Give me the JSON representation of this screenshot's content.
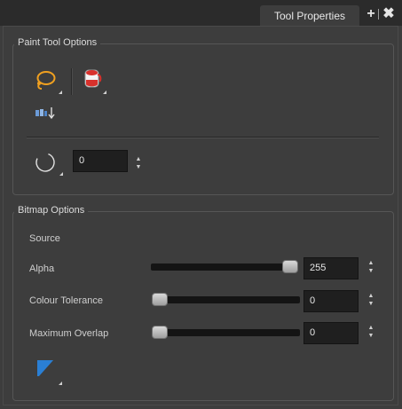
{
  "panel": {
    "tab_label": "Tool Properties",
    "add_icon": "plus-icon",
    "close_icon": "close-x-icon"
  },
  "paint_tool_options": {
    "title": "Paint Tool Options",
    "lasso_icon": "lasso-icon",
    "paint_bucket_icon": "paint-bucket-icon",
    "modes_icon": "paint-modes-arrow-icon",
    "brush_shape_icon": "brush-circle-icon",
    "size_value": "0"
  },
  "bitmap_options": {
    "title": "Bitmap Options",
    "source_label": "Source",
    "alpha": {
      "label": "Alpha",
      "value": "255",
      "level": 1.0
    },
    "colour_tolerance": {
      "label": "Colour Tolerance",
      "value": "0",
      "level": 0.0
    },
    "maximum_overlap": {
      "label": "Maximum Overlap",
      "value": "0",
      "level": 0.0
    },
    "fill_swatch_icon": "fill-swatch-icon",
    "swatch_color": "#2a7fd4"
  }
}
